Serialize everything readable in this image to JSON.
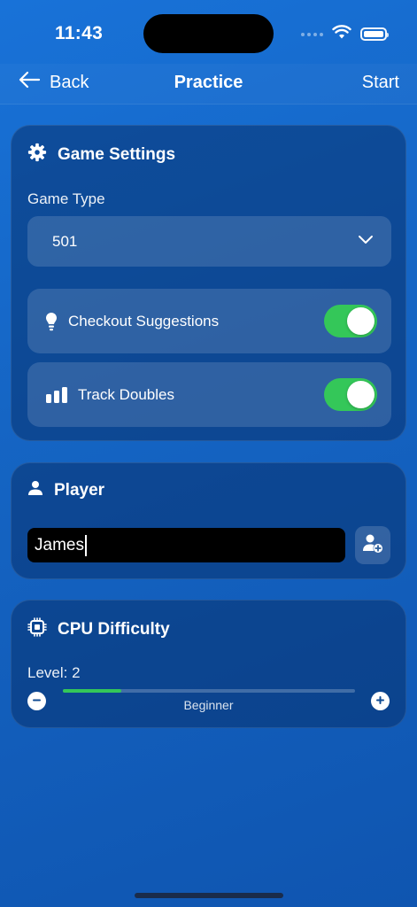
{
  "status_bar": {
    "time": "11:43",
    "icons": [
      "signal-icon",
      "wifi-icon",
      "battery-icon"
    ]
  },
  "nav": {
    "back_label": "Back",
    "title": "Practice",
    "start_label": "Start"
  },
  "game_settings": {
    "title": "Game Settings",
    "game_type_label": "Game Type",
    "game_type_value": "501",
    "toggles": [
      {
        "label": "Checkout Suggestions",
        "icon": "lightbulb-icon",
        "on": true
      },
      {
        "label": "Track Doubles",
        "icon": "bar-chart-icon",
        "on": true
      }
    ]
  },
  "player": {
    "title": "Player",
    "name_value": "James"
  },
  "cpu": {
    "title": "CPU Difficulty",
    "level_label": "Level: 2",
    "level_caption": "Beginner",
    "level_fraction": 0.2
  },
  "colors": {
    "accent_green": "#34c759",
    "background_blue": "#1565c4"
  }
}
